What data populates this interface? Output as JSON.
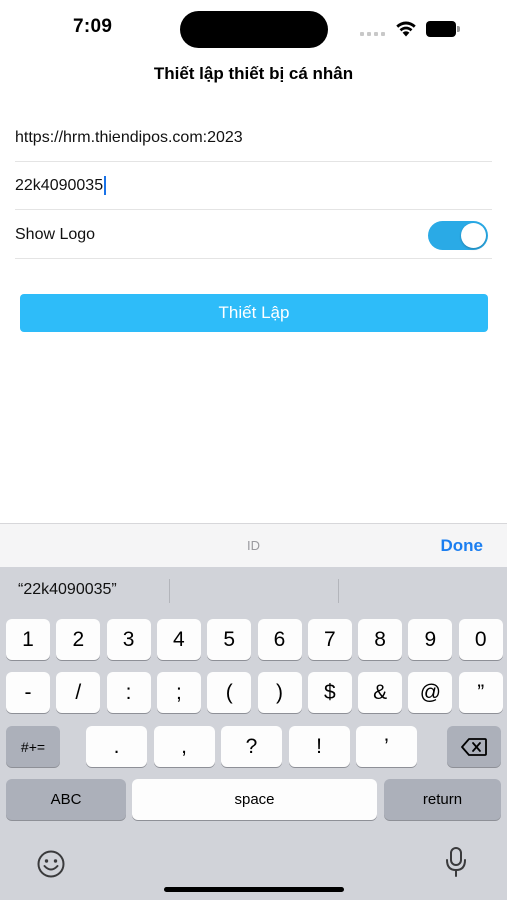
{
  "status_bar": {
    "time": "7:09"
  },
  "header": {
    "title": "Thiết lập thiết bị cá nhân"
  },
  "form": {
    "url_value": "https://hrm.thiendipos.com:2023",
    "id_value": "22k4090035",
    "show_logo_label": "Show Logo",
    "show_logo_on": true,
    "toggle_color": "#2aaae6"
  },
  "submit": {
    "label": "Thiết Lập",
    "color": "#2ebcf9"
  },
  "accessory": {
    "field_hint": "ID",
    "done_label": "Done"
  },
  "keyboard": {
    "suggestion": "“22k4090035”",
    "row1": [
      "1",
      "2",
      "3",
      "4",
      "5",
      "6",
      "7",
      "8",
      "9",
      "0"
    ],
    "row2": [
      "-",
      "/",
      ":",
      ";",
      "(",
      ")",
      "$",
      "&",
      "@",
      "”"
    ],
    "row3": [
      ".",
      ",",
      "?",
      "!",
      "’"
    ],
    "symbols_label": "#+=",
    "abc_label": "ABC",
    "space_label": "space",
    "return_label": "return",
    "delete_icon": "backspace-icon",
    "emoji_icon": "emoji-icon",
    "mic_icon": "microphone-icon"
  }
}
